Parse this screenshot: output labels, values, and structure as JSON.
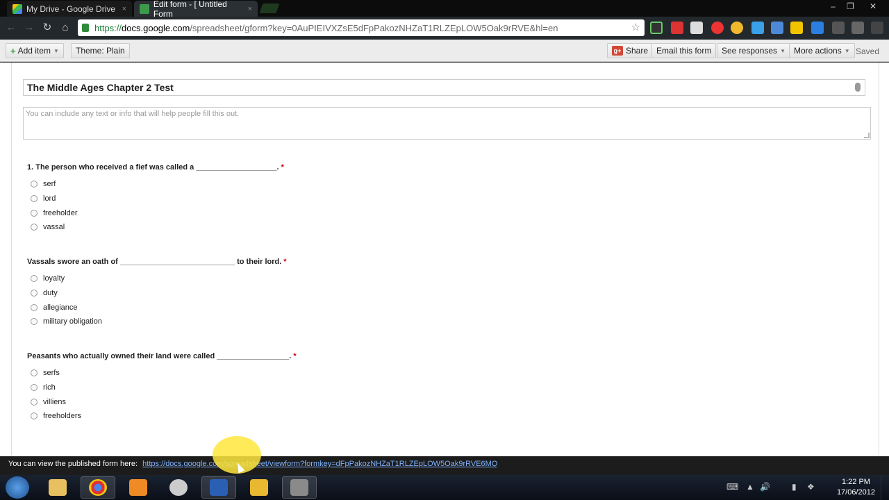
{
  "browser": {
    "tabs": [
      {
        "label": "My Drive - Google Drive",
        "icon": "google-drive-icon"
      },
      {
        "label": "Edit form - [ Untitled Form",
        "icon": "google-forms-icon"
      }
    ],
    "url": {
      "scheme": "https://",
      "host": "docs.google.com",
      "path": "/spreadsheet/gform?key=0AuPIEIVXZsE5dFpPakozNHZaT1RLZEpLOW5Oak9rRVE&hl=en"
    },
    "close_glyph": "×",
    "window_controls": {
      "minimize": "–",
      "restore": "❐",
      "close": "✕"
    }
  },
  "toolbar": {
    "add_item": "Add item",
    "theme": "Theme:  Plain",
    "share": "Share",
    "email_form": "Email this form",
    "see_responses": "See responses",
    "more_actions": "More actions",
    "status": "Saved"
  },
  "form": {
    "title": "The Middle Ages Chapter 2 Test",
    "description_placeholder": "You can include any text or info that will help people fill this out.",
    "questions": [
      {
        "title": "1. The person who received a fief was called a ___________________.",
        "required": "*",
        "options": [
          "serf",
          "lord",
          "freeholder",
          "vassal"
        ]
      },
      {
        "title": "Vassals swore an oath of ___________________________ to their lord.",
        "required": "*",
        "options": [
          "loyalty",
          "duty",
          "allegiance",
          "military obligation"
        ]
      },
      {
        "title": "Peasants who actually owned their land were called _________________.",
        "required": "*",
        "options": [
          "serfs",
          "rich",
          "villiens",
          "freeholders"
        ]
      }
    ]
  },
  "published": {
    "prefix": "You can view the published form here:",
    "link": "https://docs.google.com/spreadsheet/viewform?formkey=dFpPakozNHZaT1RLZEpLOW5Oak9rRVE6MQ"
  },
  "taskbar": {
    "time": "1:22 PM",
    "date": "17/06/2012"
  },
  "colors": {
    "accent": "#3a9a3a",
    "required": "#cc0000",
    "link": "#7fb3ff"
  }
}
